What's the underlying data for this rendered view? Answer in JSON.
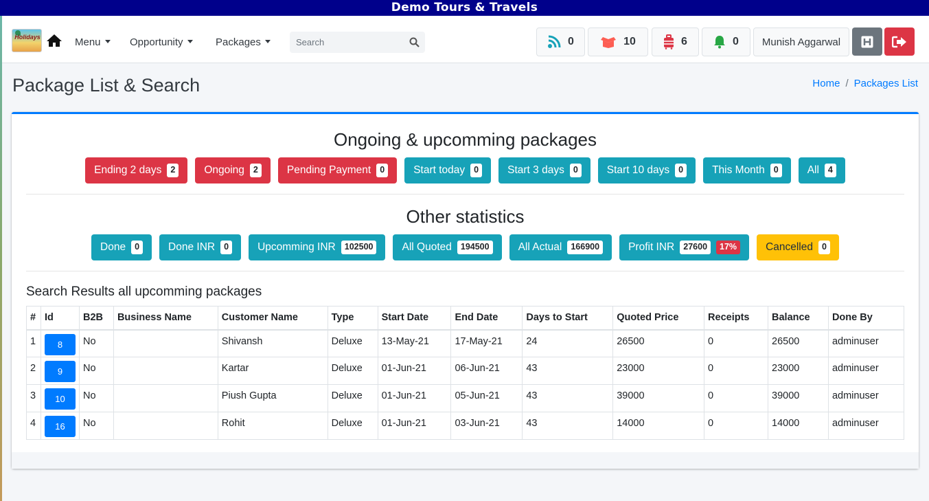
{
  "app_title": "Demo Tours & Travels",
  "logo": {
    "text": "Holidays"
  },
  "nav": {
    "menu": "Menu",
    "opportunity": "Opportunity",
    "packages": "Packages",
    "search_placeholder": "Search"
  },
  "counters": {
    "leads": "0",
    "packages": "10",
    "luggage": "6",
    "alerts": "0"
  },
  "user": {
    "name": "Munish Aggarwal"
  },
  "page": {
    "title": "Package List & Search",
    "breadcrumb_home": "Home",
    "breadcrumb_current": "Packages List"
  },
  "ongoing": {
    "heading": "Ongoing & upcomming packages",
    "buttons": [
      {
        "label": "Ending 2 days",
        "count": "2",
        "color": "#dc3545"
      },
      {
        "label": "Ongoing",
        "count": "2",
        "color": "#dc3545"
      },
      {
        "label": "Pending Payment",
        "count": "0",
        "color": "#dc3545"
      },
      {
        "label": "Start today",
        "count": "0",
        "color": "#17a2b8"
      },
      {
        "label": "Start 3 days",
        "count": "0",
        "color": "#17a2b8"
      },
      {
        "label": "Start 10 days",
        "count": "0",
        "color": "#17a2b8"
      },
      {
        "label": "This Month",
        "count": "0",
        "color": "#17a2b8"
      },
      {
        "label": "All",
        "count": "4",
        "color": "#17a2b8"
      }
    ]
  },
  "stats": {
    "heading": "Other statistics",
    "buttons": [
      {
        "label": "Done",
        "count": "0"
      },
      {
        "label": "Done INR",
        "count": "0"
      },
      {
        "label": "Upcomming INR",
        "count": "102500"
      },
      {
        "label": "All Quoted",
        "count": "194500"
      },
      {
        "label": "All Actual",
        "count": "166900"
      },
      {
        "label": "Profit INR",
        "count": "27600",
        "percent": "17%"
      },
      {
        "label": "Cancelled",
        "count": "0"
      }
    ]
  },
  "results": {
    "title": "Search Results all upcomming packages",
    "columns": [
      "#",
      "Id",
      "B2B",
      "Business Name",
      "Customer Name",
      "Type",
      "Start Date",
      "End Date",
      "Days to Start",
      "Quoted Price",
      "Receipts",
      "Balance",
      "Done By"
    ],
    "rows": [
      {
        "n": "1",
        "id": "8",
        "b2b": "No",
        "business": "",
        "customer": "Shivansh",
        "type": "Deluxe",
        "start": "13-May-21",
        "end": "17-May-21",
        "days": "24",
        "quoted": "26500",
        "receipts": "0",
        "balance": "26500",
        "done_by": "adminuser"
      },
      {
        "n": "2",
        "id": "9",
        "b2b": "No",
        "business": "",
        "customer": "Kartar",
        "type": "Deluxe",
        "start": "01-Jun-21",
        "end": "06-Jun-21",
        "days": "43",
        "quoted": "23000",
        "receipts": "0",
        "balance": "23000",
        "done_by": "adminuser"
      },
      {
        "n": "3",
        "id": "10",
        "b2b": "No",
        "business": "",
        "customer": "Piush Gupta",
        "type": "Deluxe",
        "start": "01-Jun-21",
        "end": "05-Jun-21",
        "days": "43",
        "quoted": "39000",
        "receipts": "0",
        "balance": "39000",
        "done_by": "adminuser"
      },
      {
        "n": "4",
        "id": "16",
        "b2b": "No",
        "business": "",
        "customer": "Rohit",
        "type": "Deluxe",
        "start": "01-Jun-21",
        "end": "03-Jun-21",
        "days": "43",
        "quoted": "14000",
        "receipts": "0",
        "balance": "14000",
        "done_by": "adminuser"
      }
    ]
  }
}
